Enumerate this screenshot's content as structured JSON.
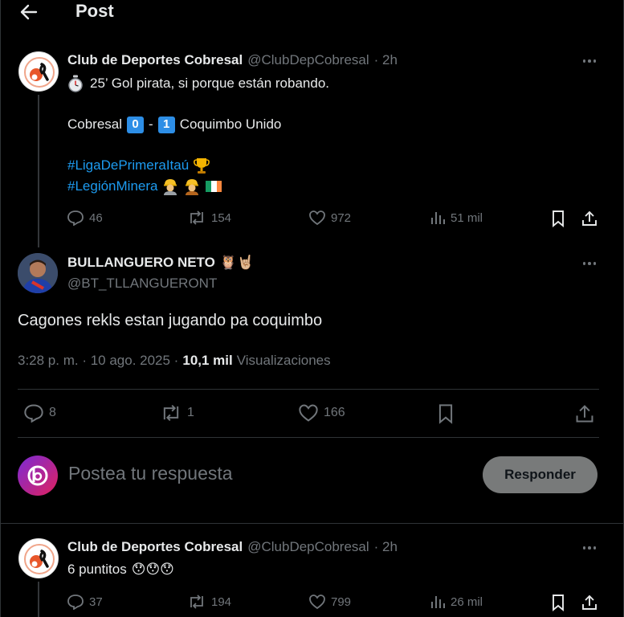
{
  "header": {
    "title": "Post"
  },
  "tweet1": {
    "name": "Club de Deportes Cobresal",
    "handle": "@ClubDepCobresal",
    "time": "· 2h",
    "line1": "25’ Gol pirata, si porque están robando.",
    "score_team1": "Cobresal",
    "score_home": "0",
    "score_sep": "-",
    "score_away": "1",
    "score_team2": "Coquimbo Unido",
    "hashtag1": "#LigaDePrimeraItaú",
    "hashtag2": "#LegiónMinera",
    "replies": "46",
    "reposts": "154",
    "likes": "972",
    "views": "51 mil"
  },
  "main": {
    "name": "BULLANGUERO NETO",
    "name_emojis": "🦉🤘🏼",
    "handle": "@BT_TLLANGUERONT",
    "text": "Cagones rekls estan jugando pa coquimbo",
    "timestamp": "3:28 p. m. · 10 ago. 2025 ·",
    "views_count": "10,1 mil",
    "views_label": "Visualizaciones",
    "replies": "8",
    "reposts": "1",
    "likes": "166"
  },
  "composer": {
    "placeholder": "Postea tu respuesta",
    "button": "Responder"
  },
  "tweet2": {
    "name": "Club de Deportes Cobresal",
    "handle": "@ClubDepCobresal",
    "time": "· 2h",
    "text": "6 puntitos",
    "emojis": "😯😯😯",
    "replies": "37",
    "reposts": "194",
    "likes": "799",
    "views": "26 mil"
  },
  "colors": {
    "accent": "#1d9bf0",
    "muted": "#71767b",
    "text": "#e7e9ea",
    "border": "#2f3336",
    "button": "#787a7a"
  }
}
